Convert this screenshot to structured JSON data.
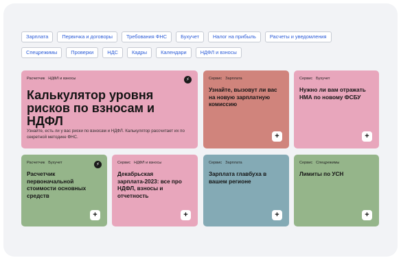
{
  "colors": {
    "pink": "#e8a6bc",
    "salmon": "#d0847c",
    "green": "#95b58a",
    "teal": "#84aab5",
    "tag_text": "#2a5bd7"
  },
  "tags": {
    "row1": [
      "Зарплата",
      "Первичка и договоры",
      "Требования ФНС",
      "Бухучет",
      "Налог на прибыль",
      "Расчеты и уведомления"
    ],
    "row2": [
      "Спецрежимы",
      "Проверки",
      "НДС",
      "Кадры",
      "Календари",
      "НДФЛ и взносы"
    ]
  },
  "cards": [
    {
      "meta": [
        "Расчетчик",
        "НДФЛ и взносы"
      ],
      "title": "Калькулятор уровня рисков по взносам и НДФЛ",
      "desc": "Узнайте, есть ли у вас риски по взносам и НДФЛ. Калькулятор рассчитает их по секретной методике ФНС.",
      "icon": "lightning-icon"
    },
    {
      "meta": [
        "Сервис",
        "Зарплата"
      ],
      "title": "Узнайте, вызовут ли вас на новую зарплатную комиссию",
      "icon": "plus-icon"
    },
    {
      "meta": [
        "Сервис",
        "Бухучет"
      ],
      "title": "Нужно ли вам отражать НМА по новому ФСБУ",
      "icon": "plus-icon"
    },
    {
      "meta": [
        "Расчетчик",
        "Бухучет"
      ],
      "title": "Расчетчик первоначальной стоимости основных средств",
      "icon": "lightning-icon"
    },
    {
      "meta": [
        "Сервис",
        "НДФЛ и взносы"
      ],
      "title": "Декабрьская зарплата-2023: все про НДФЛ, взносы и отчетность",
      "icon": "plus-icon"
    },
    {
      "meta": [
        "Сервис",
        "Зарплата"
      ],
      "title": "Зарплата главбуха в вашем регионе",
      "icon": "plus-icon"
    },
    {
      "meta": [
        "Сервис",
        "Спецрежимы"
      ],
      "title": "Лимиты по УСН",
      "icon": "plus-icon"
    }
  ],
  "symbols": {
    "plus": "+",
    "lightning": "⚡"
  }
}
